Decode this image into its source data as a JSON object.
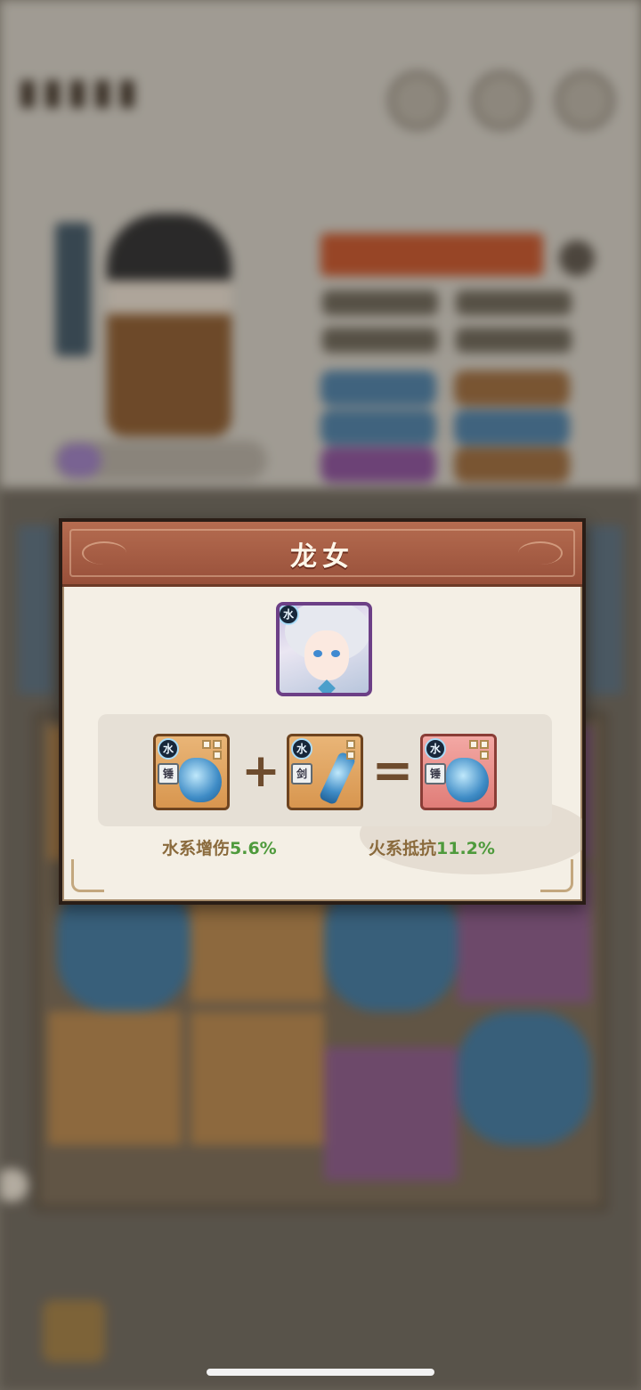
{
  "dialog": {
    "title": "龙女",
    "hero": {
      "element": "水",
      "icon": "dragon-girl-portrait"
    },
    "recipe": {
      "input_a": {
        "element": "水",
        "type": "锤",
        "icon": "water-hammer-icon"
      },
      "operator_plus": "+",
      "input_b": {
        "element": "水",
        "type": "剑",
        "icon": "water-sword-icon"
      },
      "operator_equals": "=",
      "result": {
        "element": "水",
        "type": "锤",
        "icon": "water-dragon-hammer-icon"
      }
    },
    "effects": [
      {
        "label": "水系增伤",
        "value": "5.6%"
      },
      {
        "label": "火系抵抗",
        "value": "11.2%"
      }
    ]
  },
  "colors": {
    "header": "#a85c43",
    "panel": "#f4efe5",
    "effect_label": "#8a6a3c",
    "effect_value": "#4e9a3c",
    "portrait_border": "#6c3f86"
  }
}
